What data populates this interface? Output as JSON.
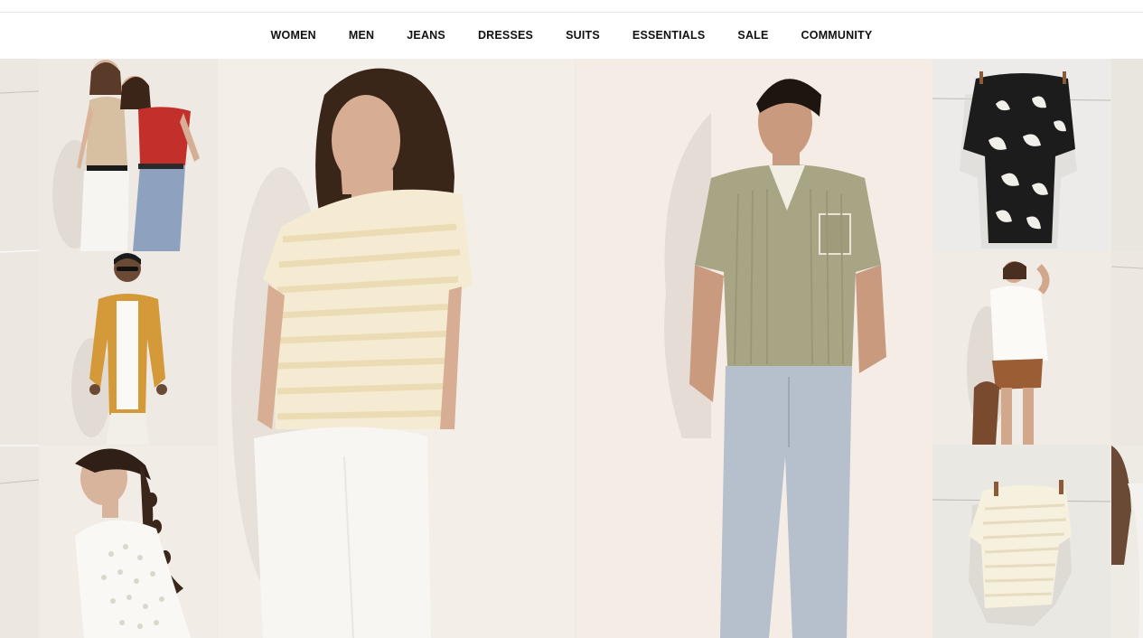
{
  "nav": {
    "items": [
      {
        "id": "women",
        "label": "WOMEN"
      },
      {
        "id": "men",
        "label": "MEN"
      },
      {
        "id": "jeans",
        "label": "JEANS"
      },
      {
        "id": "dresses",
        "label": "DRESSES"
      },
      {
        "id": "suits",
        "label": "SUITS"
      },
      {
        "id": "essentials",
        "label": "ESSENTIALS"
      },
      {
        "id": "sale",
        "label": "SALE"
      },
      {
        "id": "community",
        "label": "COMMUNITY"
      }
    ]
  },
  "colors": {
    "wall": "#f2ece5",
    "knit_polo": "#a8a585",
    "denim": "#b5c0cc",
    "mustard_shirt": "#d49a3a",
    "red_top": "#c3302b",
    "brown_shorts": "#9b5d34",
    "black_floral_shirt": "#1c1c1c"
  }
}
